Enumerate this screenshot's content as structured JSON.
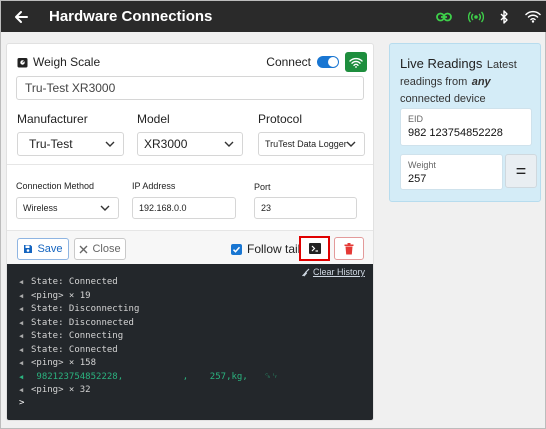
{
  "topbar": {
    "title": "Hardware Connections"
  },
  "scale": {
    "header": "Weigh Scale",
    "connect_label": "Connect",
    "connected": true,
    "name_value": "Tru-Test XR3000"
  },
  "fields": {
    "manufacturer": {
      "label": "Manufacturer",
      "value": "Tru-Test"
    },
    "model": {
      "label": "Model",
      "value": "XR3000"
    },
    "protocol": {
      "label": "Protocol",
      "value": "TruTest Data Logger"
    },
    "connection_method": {
      "label": "Connection Method",
      "value": "Wireless"
    },
    "ip_address": {
      "label": "IP Address",
      "value": "192.168.0.0"
    },
    "port": {
      "label": "Port",
      "value": "23"
    }
  },
  "actions": {
    "save_label": "Save",
    "close_label": "Close",
    "follow_tail_label": "Follow tail",
    "follow_tail_checked": true
  },
  "console": {
    "clear_label": "Clear History",
    "lines": [
      "State: Connected",
      "<ping> × 19",
      "State: Disconnecting",
      "State: Disconnected",
      "State: Connecting",
      "State: Connected",
      "<ping> × 158",
      " 982123754852228,           ,    257,kg,   ␍␊",
      "<ping> × 32"
    ],
    "prompt": ">"
  },
  "live": {
    "title": "Live Readings",
    "subtitle_pre": "Latest readings from",
    "subtitle_em": "any",
    "subtitle_post": "connected device",
    "eid_label": "EID",
    "eid_value": "982 123754852228",
    "weight_label": "Weight",
    "weight_value": "257",
    "equals_label": "="
  },
  "colors": {
    "topbar": "#2a2a2a",
    "accent": "#1976d2",
    "link_green": "#3ecf4a",
    "console_bg": "#23272b",
    "console_data": "#2bb37f",
    "live_panel_bg": "#d4ecf7",
    "delete_red": "#e53935"
  },
  "icons": {
    "back": "arrow-left-icon",
    "link": "link-icon",
    "broadcast": "broadcast-icon",
    "bluetooth": "bluetooth-icon",
    "wifi": "wifi-icon",
    "scale": "scale-icon",
    "save": "floppy-icon",
    "close": "x-icon",
    "terminal": "terminal-icon",
    "delete": "trash-icon",
    "clear": "broom-icon"
  }
}
